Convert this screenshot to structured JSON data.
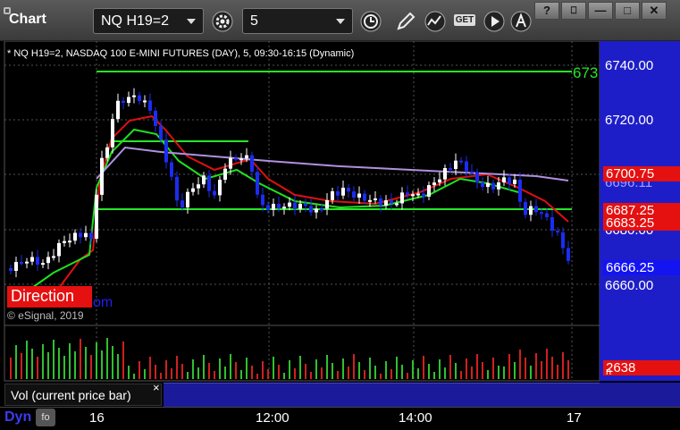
{
  "window": {
    "title": "Chart",
    "symbol_value": "NQ H19=2",
    "interval_value": "5",
    "controls": {
      "help": "?",
      "restore": "⎕",
      "minimize": "—",
      "maximize": "□",
      "close": "✕"
    }
  },
  "toolbar": {
    "icons": [
      "gear-icon",
      "clock-icon",
      "pencil-icon",
      "study-icon",
      "get-icon",
      "play-icon",
      "alert-icon"
    ],
    "get_label": "GET"
  },
  "chart": {
    "info_line": "* NQ H19=2, NASDAQ 100 E-MINI FUTURES (DAY), 5, 09:30-16:15 (Dynamic)",
    "direction_label": "Direction",
    "direction_suffix": "om",
    "copyright": "© eSignal, 2019",
    "green_level_label": "673",
    "price_labels": [
      "6740.00",
      "6720.00",
      "6700.75",
      "6696.11",
      "6687.25",
      "6683.25",
      "6680.00",
      "6666.25",
      "6660.00"
    ],
    "tags": {
      "red1": "6700.75",
      "red2": "6687.25",
      "red3": "6683.25",
      "blue_last": "6666.25",
      "vol_last": "2638",
      "vol_axis_tick": "n"
    },
    "colors": {
      "up": "#ffffff",
      "down": "#1c2cf0",
      "ma_red": "#e01010",
      "ma_green": "#20e020",
      "ma_purple": "#b090e0",
      "level_green": "#27e627",
      "axis_bg": "#1e1ec8"
    }
  },
  "volume_panel": {
    "label": "Vol (current price bar)",
    "close_glyph": "×"
  },
  "time_axis": {
    "dyn_label": "Dyn",
    "dyn_icon_label": "fo",
    "ticks": [
      "16",
      "12:00",
      "14:00",
      "17"
    ]
  }
}
